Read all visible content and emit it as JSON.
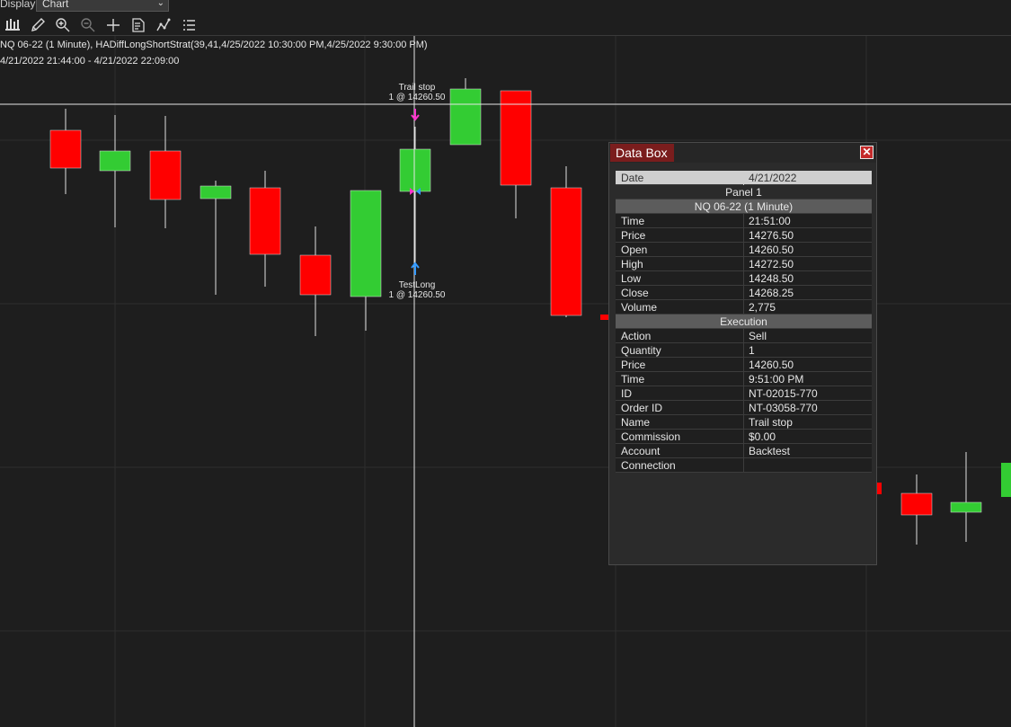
{
  "topbar": {
    "label": "Display",
    "select_value": "Chart"
  },
  "toolbar": {
    "icons": [
      "bar-style-icon",
      "pencil-icon",
      "zoom-in-icon",
      "zoom-out-icon",
      "crosshair-icon",
      "properties-icon",
      "strategy-icon",
      "list-icon"
    ]
  },
  "chart": {
    "instrument_line": "NQ 06-22 (1 Minute), HADiffLongShortStrat(39,41,4/25/2022 10:30:00 PM,4/25/2022 9:30:00 PM)",
    "range_line": "4/21/2022 21:44:00 - 4/21/2022 22:09:00",
    "colors": {
      "up": "#33cc33",
      "down": "#ff0000",
      "grid": "#2e2e2e",
      "background": "#1e1e1e"
    },
    "markers": {
      "trail_stop": {
        "name": "Trail stop",
        "detail": "1 @ 14260.50"
      },
      "test_long": {
        "name": "TestLong",
        "detail": "1 @ 14260.50"
      }
    }
  },
  "databox": {
    "title": "Data Box",
    "close_label": "✕",
    "date": {
      "label": "Date",
      "value": "4/21/2022"
    },
    "panel": "Panel 1",
    "instrument_section": "NQ 06-22 (1 Minute)",
    "bar_rows": [
      {
        "label": "Time",
        "value": "21:51:00"
      },
      {
        "label": "Price",
        "value": "14276.50"
      },
      {
        "label": "Open",
        "value": "14260.50"
      },
      {
        "label": "High",
        "value": "14272.50"
      },
      {
        "label": "Low",
        "value": "14248.50"
      },
      {
        "label": "Close",
        "value": "14268.25"
      },
      {
        "label": "Volume",
        "value": "2,775"
      }
    ],
    "execution_section": "Execution",
    "exec_rows": [
      {
        "label": "Action",
        "value": "Sell"
      },
      {
        "label": "Quantity",
        "value": "1"
      },
      {
        "label": "Price",
        "value": "14260.50"
      },
      {
        "label": "Time",
        "value": "9:51:00 PM"
      },
      {
        "label": "ID",
        "value": "NT-02015-770"
      },
      {
        "label": "Order ID",
        "value": "NT-03058-770"
      },
      {
        "label": "Name",
        "value": "Trail stop"
      },
      {
        "label": "Commission",
        "value": "$0.00"
      },
      {
        "label": "Account",
        "value": "Backtest"
      },
      {
        "label": "Connection",
        "value": ""
      }
    ]
  }
}
